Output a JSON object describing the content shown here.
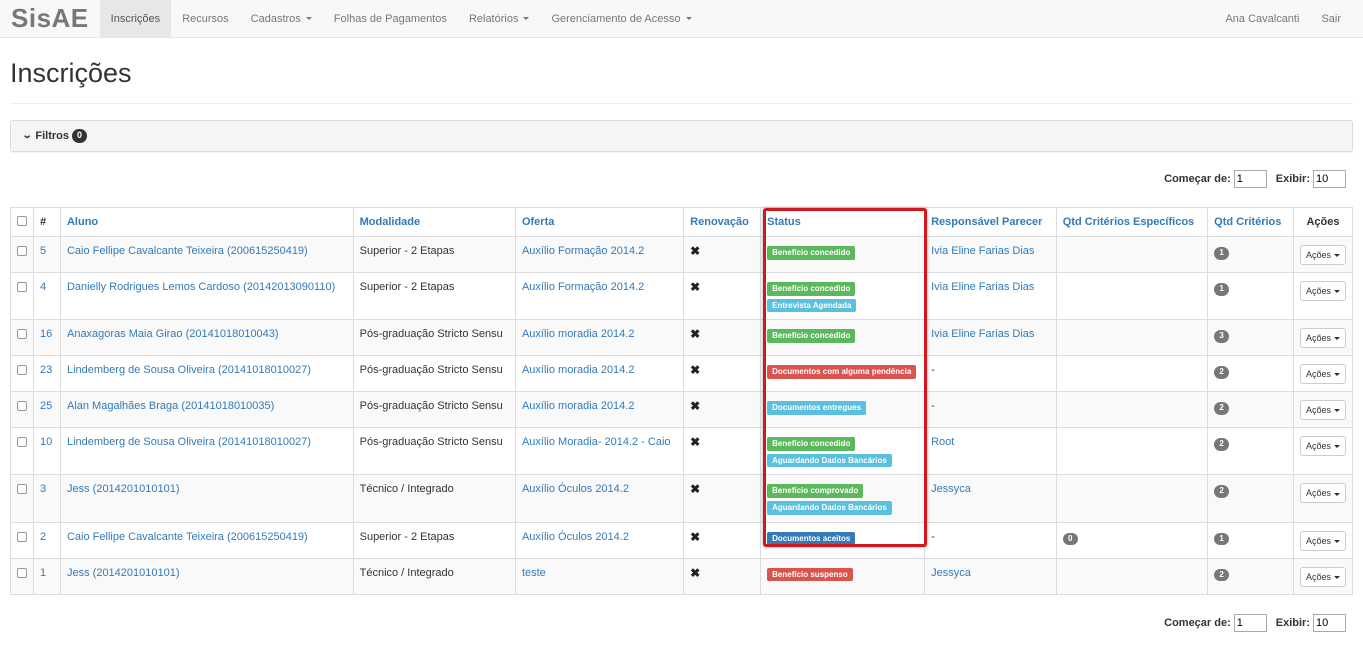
{
  "navbar": {
    "brand": "SisAE",
    "items": [
      {
        "label": "Inscrições",
        "active": true,
        "dropdown": false
      },
      {
        "label": "Recursos",
        "active": false,
        "dropdown": false
      },
      {
        "label": "Cadastros",
        "active": false,
        "dropdown": true
      },
      {
        "label": "Folhas de Pagamentos",
        "active": false,
        "dropdown": false
      },
      {
        "label": "Relatórios",
        "active": false,
        "dropdown": true
      },
      {
        "label": "Gerenciamento de Acesso",
        "active": false,
        "dropdown": true
      }
    ],
    "user": "Ana Cavalcanti",
    "logout": "Sair"
  },
  "page": {
    "title": "Inscrições"
  },
  "filters": {
    "label": "Filtros",
    "count": "0"
  },
  "pagination": {
    "start_label": "Começar de:",
    "start_value": "1",
    "show_label": "Exibir:",
    "show_value": "10"
  },
  "table": {
    "headers": {
      "num": "#",
      "aluno": "Aluno",
      "modalidade": "Modalidade",
      "oferta": "Oferta",
      "renovacao": "Renovação",
      "status": "Status",
      "responsavel": "Responsável Parecer",
      "qtd_especificos": "Qtd Critérios Específicos",
      "qtd_criterios": "Qtd Critérios",
      "acoes": "Ações"
    },
    "action_button": "Ações",
    "renovacao_mark": "✖",
    "rows": [
      {
        "id": "5",
        "aluno": "Caio Fellipe Cavalcante Teixeira (200615250419)",
        "modalidade": "Superior - 2 Etapas",
        "oferta": "Auxílio Formação 2014.2",
        "status": [
          {
            "text": "Benefício concedido",
            "color": "#5cb85c"
          }
        ],
        "responsavel": "Ivia Eline Farias Dias",
        "qtd_especificos": "",
        "qtd_criterios": "1"
      },
      {
        "id": "4",
        "aluno": "Danielly Rodrigues Lemos Cardoso (20142013090110)",
        "modalidade": "Superior - 2 Etapas",
        "oferta": "Auxílio Formação 2014.2",
        "status": [
          {
            "text": "Benefício concedido",
            "color": "#5cb85c"
          },
          {
            "text": "Entrevista Agendada",
            "color": "#5bc0de"
          }
        ],
        "responsavel": "Ivia Eline Farias Dias",
        "qtd_especificos": "",
        "qtd_criterios": "1"
      },
      {
        "id": "16",
        "aluno": "Anaxagoras Maia Girao (20141018010043)",
        "modalidade": "Pós-graduação Stricto Sensu",
        "oferta": "Auxílio moradia 2014.2",
        "status": [
          {
            "text": "Benefício concedido",
            "color": "#5cb85c"
          }
        ],
        "responsavel": "Ivia Eline Farias Dias",
        "qtd_especificos": "",
        "qtd_criterios": "3"
      },
      {
        "id": "23",
        "aluno": "Lindemberg de Sousa Oliveira (20141018010027)",
        "modalidade": "Pós-graduação Stricto Sensu",
        "oferta": "Auxílio moradia 2014.2",
        "status": [
          {
            "text": "Documentos com alguma pendência",
            "color": "#d9534f"
          }
        ],
        "responsavel": "-",
        "qtd_especificos": "",
        "qtd_criterios": "2"
      },
      {
        "id": "25",
        "aluno": "Alan Magalhães Braga (20141018010035)",
        "modalidade": "Pós-graduação Stricto Sensu",
        "oferta": "Auxílio moradia 2014.2",
        "status": [
          {
            "text": "Documentos entregues",
            "color": "#5bc0de"
          }
        ],
        "responsavel": "-",
        "qtd_especificos": "",
        "qtd_criterios": "2"
      },
      {
        "id": "10",
        "aluno": "Lindemberg de Sousa Oliveira (20141018010027)",
        "modalidade": "Pós-graduação Stricto Sensu",
        "oferta": "Auxílio Moradia- 2014.2 - Caio",
        "status": [
          {
            "text": "Benefício concedido",
            "color": "#5cb85c"
          },
          {
            "text": "Aguardando Dados Bancários",
            "color": "#5bc0de"
          }
        ],
        "responsavel": "Root",
        "qtd_especificos": "",
        "qtd_criterios": "2"
      },
      {
        "id": "3",
        "aluno": "Jess (2014201010101)",
        "modalidade": "Técnico / Integrado",
        "oferta": "Auxílio Óculos 2014.2",
        "status": [
          {
            "text": "Benefício comprovado",
            "color": "#5cb85c"
          },
          {
            "text": "Aguardando Dados Bancários",
            "color": "#5bc0de"
          }
        ],
        "responsavel": "Jessyca",
        "qtd_especificos": "",
        "qtd_criterios": "2"
      },
      {
        "id": "2",
        "aluno": "Caio Fellipe Cavalcante Teixeira (200615250419)",
        "modalidade": "Superior - 2 Etapas",
        "oferta": "Auxílio Óculos 2014.2",
        "status": [
          {
            "text": "Documentos aceitos",
            "color": "#337ab7"
          }
        ],
        "responsavel": "-",
        "qtd_especificos": "0",
        "qtd_criterios": "1"
      },
      {
        "id": "1",
        "aluno": "Jess (2014201010101)",
        "modalidade": "Técnico / Integrado",
        "oferta": "teste",
        "status": [
          {
            "text": "Benefício suspenso",
            "color": "#d9534f"
          }
        ],
        "responsavel": "Jessyca",
        "qtd_especificos": "",
        "qtd_criterios": "2"
      }
    ]
  }
}
